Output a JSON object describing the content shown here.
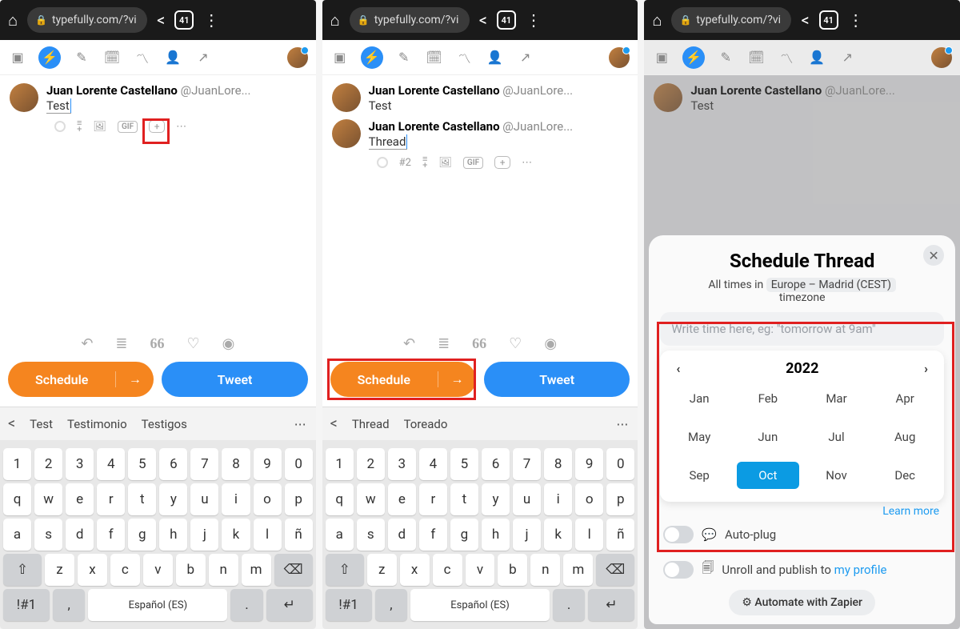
{
  "browser": {
    "url": "typefully.com/?vi",
    "tab_count": "41"
  },
  "user": {
    "name": "Juan Lorente Castellano",
    "handle": "@JuanLore..."
  },
  "screen1": {
    "compose_text": "Test",
    "schedule_label": "Schedule",
    "tweet_label": "Tweet",
    "suggestions": {
      "s1": "Test",
      "s2": "Testimonio",
      "s3": "Testigos"
    }
  },
  "screen2": {
    "compose_text": "Test",
    "compose_text2": "Thread",
    "thread_counter": "#2",
    "schedule_label": "Schedule",
    "tweet_label": "Tweet",
    "suggestions": {
      "s1": "Thread",
      "s2": "Toreado"
    }
  },
  "screen3": {
    "title": "Schedule Thread",
    "tz_prefix": "All times in",
    "tz_chip": "Europe – Madrid (CEST)",
    "tz_suffix": "timezone",
    "time_placeholder": "Write time here, eg: \"tomorrow at 9am\"",
    "year": "2022",
    "months": {
      "m1": "Jan",
      "m2": "Feb",
      "m3": "Mar",
      "m4": "Apr",
      "m5": "May",
      "m6": "Jun",
      "m7": "Jul",
      "m8": "Aug",
      "m9": "Sep",
      "m10": "Oct",
      "m11": "Nov",
      "m12": "Dec"
    },
    "learn_more": "Learn more",
    "auto_plug": "Auto-plug",
    "unroll_text": "Unroll and publish to",
    "profile_link": "my profile",
    "zapier": "Automate with Zapier"
  },
  "keyboard": {
    "numbers": {
      "k1": "1",
      "k2": "2",
      "k3": "3",
      "k4": "4",
      "k5": "5",
      "k6": "6",
      "k7": "7",
      "k8": "8",
      "k9": "9",
      "k0": "0"
    },
    "row1": {
      "q": "q",
      "w": "w",
      "e": "e",
      "r": "r",
      "t": "t",
      "y": "y",
      "u": "u",
      "i": "i",
      "o": "o",
      "p": "p"
    },
    "row2": {
      "a": "a",
      "s": "s",
      "d": "d",
      "f": "f",
      "g": "g",
      "h": "h",
      "j": "j",
      "k": "k",
      "l": "l",
      "n": "ñ"
    },
    "row3": {
      "z": "z",
      "x": "x",
      "c": "c",
      "v": "v",
      "b": "b",
      "n": "n",
      "m": "m"
    },
    "symkey": "!#1",
    "comma": ",",
    "space": "Español (ES)",
    "period": "."
  },
  "icons": {
    "gif": "GIF",
    "quote": "66"
  }
}
